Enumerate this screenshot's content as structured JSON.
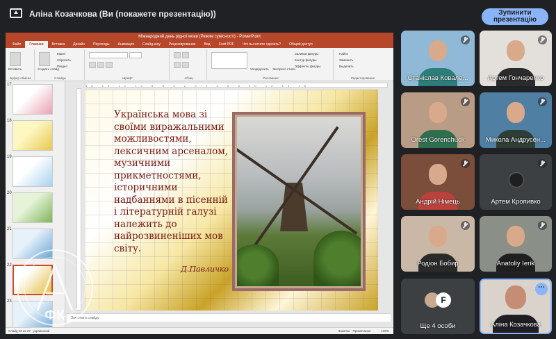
{
  "presentation": {
    "title": "Аліна Козачкова (Ви (покажете презентацію))",
    "stop_label": "Зупинити презентацію"
  },
  "ppt": {
    "window_title": "Міжнародний день рідної мови (Режим сумісності) - PowerPoint",
    "tabs": [
      "Файл",
      "Главная",
      "Вставка",
      "Дизайн",
      "Переходы",
      "Анимация",
      "Слайд-шоу",
      "Рецензирование",
      "Вид",
      "Foxit PDF",
      "Что вы хотите сделать?",
      "Общий доступ"
    ],
    "active_tab": 1,
    "ribbon_groups": [
      "Буфер обмена",
      "Слайды",
      "Шрифт",
      "Абзац",
      "Рисование",
      "Редактирование"
    ],
    "ribbon_items": {
      "paste": "Вставить",
      "create_slide": "Создать слайд",
      "layout": "Макет",
      "reset": "Сбросить",
      "section": "Раздел",
      "arrange": "Упорядочить",
      "express_styles": "Экспресс-стили",
      "fill": "Заливка фигуры",
      "outline": "Контур фигуры",
      "effects": "Эффекты фигуры",
      "find": "Найти",
      "replace": "Заменить",
      "select": "Выделить"
    },
    "thumbnail_numbers": [
      "17",
      "18",
      "19",
      "20",
      "21",
      "22",
      "23"
    ],
    "selected_slide": "22",
    "slide": {
      "text": "Українська мова зі своїми виражальними можливостями, лексичним арсеналом, музичними прикметностями, історичними надбаннями в пісенній і літературній галузі належить до найрозвиненіших мов світу.",
      "author": "Д.Павличко"
    },
    "notes_placeholder": "Заметки к слайду",
    "status": {
      "slide_counter": "Слайд 22 из 27",
      "language": "украинский",
      "notes": "Заметки",
      "comments": "Примечания",
      "zoom": "100%"
    }
  },
  "participants": [
    {
      "name": "Станіслав Ковале...",
      "muted": true,
      "bg": "#8fb9d6",
      "shirt": "#2d7d7a"
    },
    {
      "name": "Артем Гончаренко",
      "muted": true,
      "bg": "#e3e0dc",
      "shirt": "#2b2b2b"
    },
    {
      "name": "Orest Gorenchuck",
      "muted": true,
      "bg": "#b99c86",
      "shirt": "#2f6e4f"
    },
    {
      "name": "Микола Андрусен...",
      "muted": true,
      "bg": "#4f7fa3",
      "shirt": "#2c3e35"
    },
    {
      "name": "Андрій Німець",
      "muted": true,
      "bg": "#7b4d3b",
      "shirt": "#b9423c"
    },
    {
      "name": "Артем Кропивко",
      "muted": true,
      "bg": "#3c4043",
      "shirt": ""
    },
    {
      "name": "Родіон Бобир",
      "muted": true,
      "bg": "#c9b8a6",
      "shirt": "#2a2a2a"
    },
    {
      "name": "Anatoliy Ierik",
      "muted": true,
      "bg": "#8a8f88",
      "shirt": "#1f1f1f"
    }
  ],
  "more_tile": {
    "label": "Ще 4 особи"
  },
  "self_tile": {
    "name": "Аліна Козачкова"
  },
  "watermark": {
    "text": "ФК"
  }
}
